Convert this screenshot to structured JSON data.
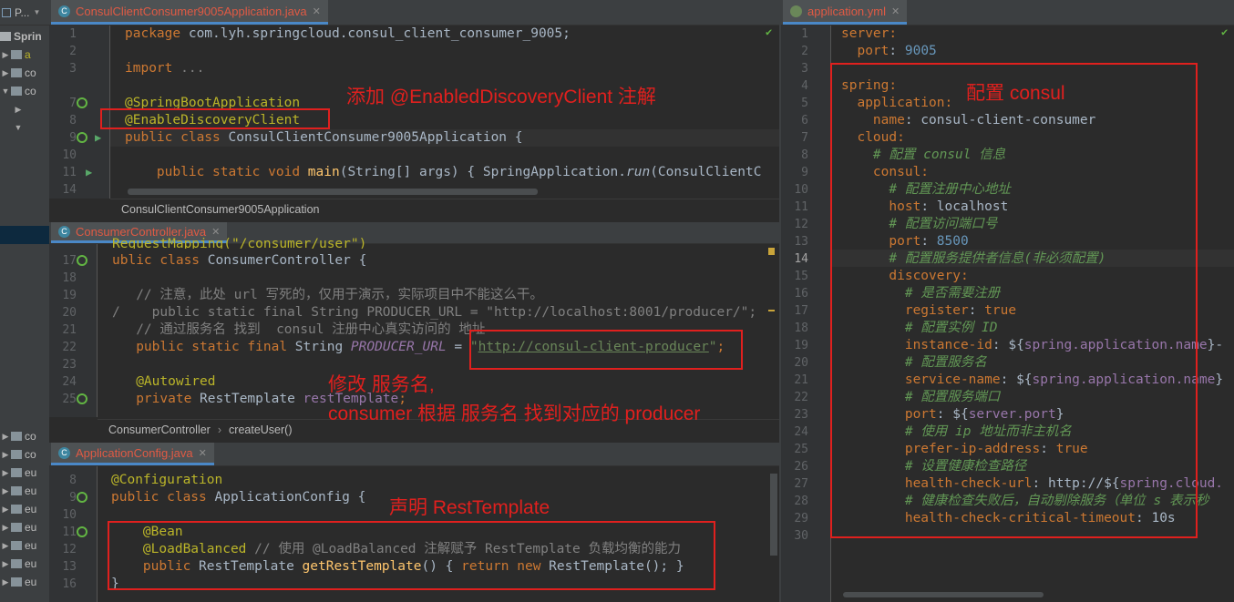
{
  "project": {
    "title": "P...",
    "root_label": "Sprin",
    "items": [
      "co",
      "co",
      "co",
      "eu",
      "eu",
      "eu",
      "eu",
      "eu",
      "eu"
    ],
    "extra": [
      "a"
    ]
  },
  "editor1": {
    "tab": "ConsulClientConsumer9005Application.java",
    "breadcrumb": "ConsulClientConsumer9005Application",
    "line_numbers": [
      "1",
      "2",
      "3",
      "",
      "7",
      "8",
      "9",
      "10",
      "11",
      "14"
    ],
    "lines": [
      [
        {
          "t": "package",
          "c": "kw"
        },
        {
          "t": " com.lyh.springcloud.consul_client_consumer_9005;"
        }
      ],
      [],
      [
        {
          "t": "import",
          "c": "kw"
        },
        {
          "t": " ...",
          "c": "cm"
        }
      ],
      [],
      [
        {
          "t": "@SpringBootApplication",
          "c": "an"
        }
      ],
      [
        {
          "t": "@EnableDiscoveryClient",
          "c": "an"
        }
      ],
      [
        {
          "t": "public class",
          "c": "kw"
        },
        {
          "t": " ConsulClientConsumer9005Application {"
        }
      ],
      [],
      [
        {
          "t": "    "
        },
        {
          "t": "public static void",
          "c": "kw"
        },
        {
          "t": " "
        },
        {
          "t": "main",
          "c": "fn"
        },
        {
          "t": "(String[] args) { SpringApplication."
        },
        {
          "t": "run",
          "c": "it"
        },
        {
          "t": "(ConsulClientC"
        }
      ],
      []
    ]
  },
  "editor2": {
    "tab": "ConsumerController.java",
    "top_partial": "RequestMapping(\"/consumer/user\")",
    "line_numbers": [
      "17",
      "18",
      "19",
      "20",
      "21",
      "22",
      "23",
      "24",
      "25"
    ],
    "lines": [
      [
        {
          "t": "ublic class",
          "c": "kw"
        },
        {
          "t": " ConsumerController {"
        }
      ],
      [],
      [
        {
          "t": "   // 注意，此处 url 写死的，仅用于演示，实际项目中不能这么干。",
          "c": "cm"
        }
      ],
      [
        {
          "t": "/    public static final String PRODUCER_URL = \"http://localhost:8001/producer/\";",
          "c": "cm"
        }
      ],
      [
        {
          "t": "   // 通过服务名 找到  consul 注册中心真实访问的 地址",
          "c": "cm"
        }
      ],
      [
        {
          "t": "   "
        },
        {
          "t": "public static final",
          "c": "kw"
        },
        {
          "t": " String "
        },
        {
          "t": "PRODUCER_URL",
          "c": "fld"
        },
        {
          "t": " = "
        },
        {
          "t": "\"",
          "c": "str"
        },
        {
          "t": "http://consul-client-producer",
          "c": "link"
        },
        {
          "t": "\"",
          "c": "str"
        },
        {
          "t": ";",
          "c": "kw"
        }
      ],
      [],
      [
        {
          "t": "   @Autowired",
          "c": "an"
        }
      ],
      [
        {
          "t": "   "
        },
        {
          "t": "private",
          "c": "kw"
        },
        {
          "t": " RestTemplate "
        },
        {
          "t": "restTemplate",
          "c": "inst"
        },
        {
          "t": ";",
          "c": "kw"
        }
      ]
    ],
    "breadcrumb": [
      "ConsumerController",
      "createUser()"
    ]
  },
  "editor3": {
    "tab": "ApplicationConfig.java",
    "line_numbers": [
      "8",
      "9",
      "10",
      "11",
      "12",
      "13",
      "16"
    ],
    "lines": [
      [
        {
          "t": "@Configuration",
          "c": "an"
        }
      ],
      [
        {
          "t": "public class",
          "c": "kw"
        },
        {
          "t": " ApplicationConfig {"
        }
      ],
      [],
      [
        {
          "t": "    @Bean",
          "c": "an"
        }
      ],
      [
        {
          "t": "    @LoadBalanced",
          "c": "an"
        },
        {
          "t": " // 使用 @LoadBalanced 注解赋予 RestTemplate 负载均衡的能力",
          "c": "cm"
        }
      ],
      [
        {
          "t": "    "
        },
        {
          "t": "public",
          "c": "kw"
        },
        {
          "t": " RestTemplate "
        },
        {
          "t": "getRestTemplate",
          "c": "fn"
        },
        {
          "t": "() { "
        },
        {
          "t": "return new",
          "c": "kw"
        },
        {
          "t": " RestTemplate(); }"
        }
      ],
      [
        {
          "t": "}"
        }
      ]
    ]
  },
  "editor4": {
    "tab": "application.yml",
    "line_numbers": [
      "1",
      "2",
      "3",
      "4",
      "5",
      "6",
      "7",
      "8",
      "9",
      "10",
      "11",
      "12",
      "13",
      "14",
      "15",
      "16",
      "17",
      "18",
      "19",
      "20",
      "21",
      "22",
      "23",
      "24",
      "25",
      "26",
      "27",
      "28",
      "29",
      "30"
    ],
    "lines": [
      [
        {
          "t": "server:",
          "c": "ykey"
        }
      ],
      [
        {
          "t": "  port",
          "c": "ykey"
        },
        {
          "t": ": "
        },
        {
          "t": "9005",
          "c": "ynum"
        }
      ],
      [],
      [
        {
          "t": "spring:",
          "c": "ykey"
        }
      ],
      [
        {
          "t": "  application:",
          "c": "ykey"
        }
      ],
      [
        {
          "t": "    name",
          "c": "ykey"
        },
        {
          "t": ": consul-client-consumer"
        }
      ],
      [
        {
          "t": "  cloud:",
          "c": "ykey"
        }
      ],
      [
        {
          "t": "    # 配置 consul 信息",
          "c": "ycm"
        }
      ],
      [
        {
          "t": "    consul:",
          "c": "ykey"
        }
      ],
      [
        {
          "t": "      # 配置注册中心地址",
          "c": "ycm"
        }
      ],
      [
        {
          "t": "      host",
          "c": "ykey"
        },
        {
          "t": ": localhost"
        }
      ],
      [
        {
          "t": "      # 配置访问端口号",
          "c": "ycm"
        }
      ],
      [
        {
          "t": "      port",
          "c": "ykey"
        },
        {
          "t": ": "
        },
        {
          "t": "8500",
          "c": "ynum"
        }
      ],
      [
        {
          "t": "      # 配置服务提供者信息(非必须配置)",
          "c": "ycm"
        }
      ],
      [
        {
          "t": "      discovery:",
          "c": "ykey"
        }
      ],
      [
        {
          "t": "        # 是否需要注册",
          "c": "ycm"
        }
      ],
      [
        {
          "t": "        register",
          "c": "ykey"
        },
        {
          "t": ": "
        },
        {
          "t": "true",
          "c": "kw"
        }
      ],
      [
        {
          "t": "        # 配置实例 ID",
          "c": "ycm"
        }
      ],
      [
        {
          "t": "        instance-id",
          "c": "ykey"
        },
        {
          "t": ": ${"
        },
        {
          "t": "spring.application.name",
          "c": "yph"
        },
        {
          "t": "}-"
        }
      ],
      [
        {
          "t": "        # 配置服务名",
          "c": "ycm"
        }
      ],
      [
        {
          "t": "        service-name",
          "c": "ykey"
        },
        {
          "t": ": ${"
        },
        {
          "t": "spring.application.name",
          "c": "yph"
        },
        {
          "t": "}"
        }
      ],
      [
        {
          "t": "        # 配置服务端口",
          "c": "ycm"
        }
      ],
      [
        {
          "t": "        port",
          "c": "ykey"
        },
        {
          "t": ": ${"
        },
        {
          "t": "server.port",
          "c": "yph"
        },
        {
          "t": "}"
        }
      ],
      [
        {
          "t": "        # 使用 ip 地址而非主机名",
          "c": "ycm"
        }
      ],
      [
        {
          "t": "        prefer-ip-address",
          "c": "ykey"
        },
        {
          "t": ": "
        },
        {
          "t": "true",
          "c": "kw"
        }
      ],
      [
        {
          "t": "        # 设置健康检查路径",
          "c": "ycm"
        }
      ],
      [
        {
          "t": "        health-check-url",
          "c": "ykey"
        },
        {
          "t": ": http://${"
        },
        {
          "t": "spring.cloud.",
          "c": "yph"
        }
      ],
      [
        {
          "t": "        # 健康检查失败后，自动剔除服务（单位 s 表示秒",
          "c": "ycm"
        }
      ],
      [
        {
          "t": "        health-check-critical-timeout",
          "c": "ykey"
        },
        {
          "t": ": 10s"
        }
      ],
      []
    ]
  },
  "annotations": {
    "a1": "添加 @EnabledDiscoveryClient 注解",
    "a2": "修改 服务名,",
    "a3": "consumer 根据 服务名 找到对应的 producer",
    "a4": "声明 RestTemplate",
    "a5": "配置 consul"
  },
  "colors": {
    "annotation": "#e0201e",
    "tab_text": "#e05a44",
    "keyword": "#cc7832",
    "annotation_code": "#bbb529",
    "string": "#6a8759"
  }
}
